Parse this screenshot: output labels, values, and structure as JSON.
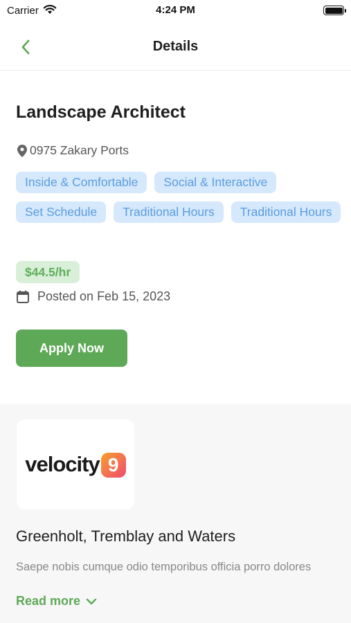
{
  "status_bar": {
    "carrier": "Carrier",
    "time": "4:24 PM"
  },
  "nav": {
    "title": "Details"
  },
  "job": {
    "title": "Landscape Architect",
    "location": "0975 Zakary Ports",
    "tags": [
      "Inside & Comfortable",
      "Social & Interactive",
      "Set Schedule",
      "Traditional Hours",
      "Traditional Hours"
    ],
    "rate": "$44.5/hr",
    "posted": "Posted on Feb 15, 2023",
    "apply_label": "Apply Now"
  },
  "company": {
    "logo_text": "velocity",
    "logo_badge": "9",
    "name": "Greenholt, Tremblay and Waters",
    "description": "Saepe nobis cumque odio temporibus officia porro dolores",
    "read_more_label": "Read more"
  },
  "colors": {
    "accent_green": "#5ea957",
    "tag_blue_bg": "#d6e8fb",
    "tag_blue_text": "#5a9de0",
    "rate_green_bg": "#d9efd8"
  }
}
